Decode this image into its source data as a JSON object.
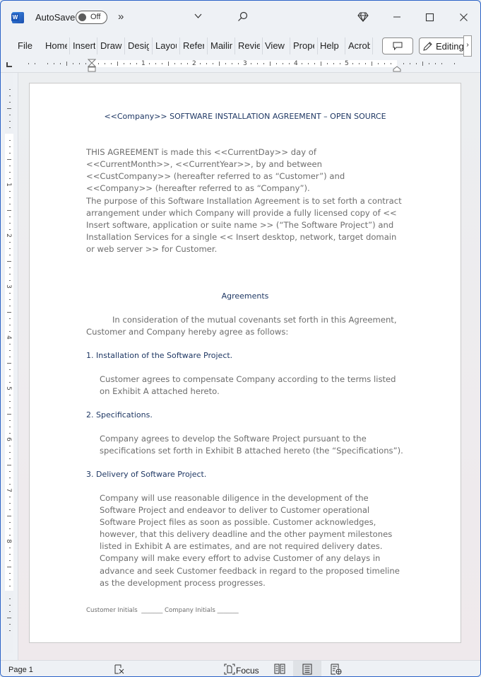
{
  "titlebar": {
    "app_icon": "word-logo-icon",
    "autosave_label": "AutoSave",
    "autosave_state": "Off",
    "overflow_label": "»",
    "dropdown_icon": "chevron-down-icon",
    "search_icon": "search-icon",
    "premium_icon": "diamond-icon",
    "minimize_icon": "minimize-icon",
    "maximize_icon": "maximize-icon",
    "close_icon": "close-icon"
  },
  "ribbon": {
    "tabs": [
      {
        "label": "File"
      },
      {
        "label": "Home"
      },
      {
        "label": "Insert"
      },
      {
        "label": "Draw"
      },
      {
        "label": "Design"
      },
      {
        "label": "Layout"
      },
      {
        "label": "References"
      },
      {
        "label": "Mailings"
      },
      {
        "label": "Review"
      },
      {
        "label": "View"
      },
      {
        "label": "Properties"
      },
      {
        "label": "Help"
      },
      {
        "label": "Acrobat"
      }
    ],
    "comment_button_icon": "comment-icon",
    "editing_label": "Editing",
    "editing_icon": "pencil-icon",
    "expand_icon": "chevron-right-icon"
  },
  "ruler": {
    "horizontal_labels": [
      "1",
      "2",
      "3",
      "4",
      "5"
    ],
    "vertical_labels": [
      "1",
      "2",
      "3",
      "4",
      "5",
      "6",
      "7",
      "8"
    ]
  },
  "document": {
    "title": "<<Company>> SOFTWARE INSTALLATION AGREEMENT – OPEN SOURCE",
    "intro_paragraph": "THIS AGREEMENT is made this <<CurrentDay>> day of <<CurrentMonth>>, <<CurrentYear>>, by and between <<CustCompany>> (hereafter referred to as “Customer”) and <<Company>> (hereafter referred to as “Company”).",
    "purpose_paragraph": "The purpose of this Software Installation Agreement is to set forth a contract arrangement under which Company will provide a fully licensed copy of << Insert software, application or suite name >> (“The Software Project”) and Installation Services for a single << Insert desktop, network, target domain or web server >> for Customer.",
    "agreements_heading": "Agreements",
    "consideration_paragraph": "In consideration of the mutual covenants set forth in this Agreement, Customer and Company hereby agree as follows:",
    "sections": [
      {
        "heading": "1. Installation of the Software Project.",
        "body": "Customer agrees to compensate Company according to the terms listed on Exhibit A attached hereto."
      },
      {
        "heading": "2. Specifications.",
        "body": "Company agrees to develop the Software Project pursuant to the specifications set forth in Exhibit B attached hereto (the “Specifications”)."
      },
      {
        "heading": "3. Delivery of Software Project.",
        "body": "Company will use reasonable diligence in the development of the Software Project and endeavor to deliver to Customer operational Software Project files as soon as possible. Customer acknowledges, however, that this delivery deadline and the other payment milestones listed in Exhibit A are estimates, and are not required delivery dates. Company will make every effort to advise Customer of any delays in advance and seek Customer feedback in regard to the proposed timeline as the development process progresses."
      }
    ],
    "footer_initials": "Customer Initials  _______ Company Initials _______"
  },
  "statusbar": {
    "page_label": "Page 1",
    "proofing_icon": "proofing-icon",
    "focus_label": "Focus",
    "focus_icon": "focus-icon",
    "read_mode_icon": "read-mode-icon",
    "print_layout_icon": "print-layout-icon",
    "web_layout_icon": "web-layout-icon"
  }
}
